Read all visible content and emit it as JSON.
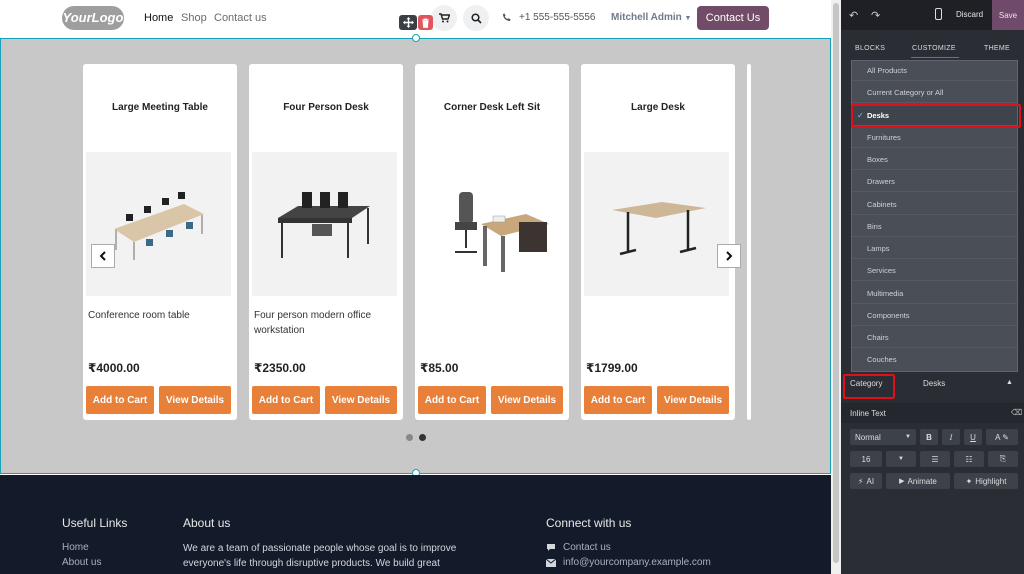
{
  "navbar": {
    "logo": "YourLogo",
    "links": [
      "Home",
      "Shop",
      "Contact us"
    ],
    "phone": "+1 555-555-5556",
    "user": "Mitchell Admin",
    "contact_button": "Contact Us"
  },
  "products": [
    {
      "name": "Large Meeting Table",
      "description": "Conference room table",
      "price": "₹4000.00"
    },
    {
      "name": "Four Person Desk",
      "description": "Four person modern office workstation",
      "price": "₹2350.00"
    },
    {
      "name": "Corner Desk Left Sit",
      "description": "",
      "price": "₹85.00"
    },
    {
      "name": "Large Desk",
      "description": "",
      "price": "₹1799.00"
    }
  ],
  "product_buttons": {
    "add_to_cart": "Add to Cart",
    "view_details": "View Details"
  },
  "carousel": {
    "pages": 2,
    "active_page": 2
  },
  "footer": {
    "useful_links": {
      "title": "Useful Links",
      "items": [
        "Home",
        "About us"
      ]
    },
    "about": {
      "title": "About us",
      "text": "We are a team of passionate people whose goal is to improve everyone's life through disruptive products. We build great"
    },
    "connect": {
      "title": "Connect with us",
      "contact": "Contact us",
      "email": "info@yourcompany.example.com"
    }
  },
  "panel": {
    "discard": "Discard",
    "save": "Save",
    "tabs": [
      "BLOCKS",
      "CUSTOMIZE",
      "THEME"
    ],
    "active_tab": "CUSTOMIZE",
    "category_options": [
      "All Products",
      "Current Category or All",
      "Desks",
      "Furnitures",
      "Boxes",
      "Drawers",
      "Cabinets",
      "Bins",
      "Lamps",
      "Services",
      "Multimedia",
      "Components",
      "Chairs",
      "Couches"
    ],
    "selected_category": "Desks",
    "category_label": "Category",
    "inline_text_label": "Inline Text",
    "font_style": "Normal",
    "font_size": "16",
    "ai_button": "AI",
    "animate_button": "Animate",
    "highlight_button": "Highlight"
  },
  "colors": {
    "accent_purple": "#714b67",
    "orange": "#e8803a",
    "footer_bg": "#131b2b",
    "selection": "#17a2b8",
    "highlight_red": "#e0101a"
  }
}
